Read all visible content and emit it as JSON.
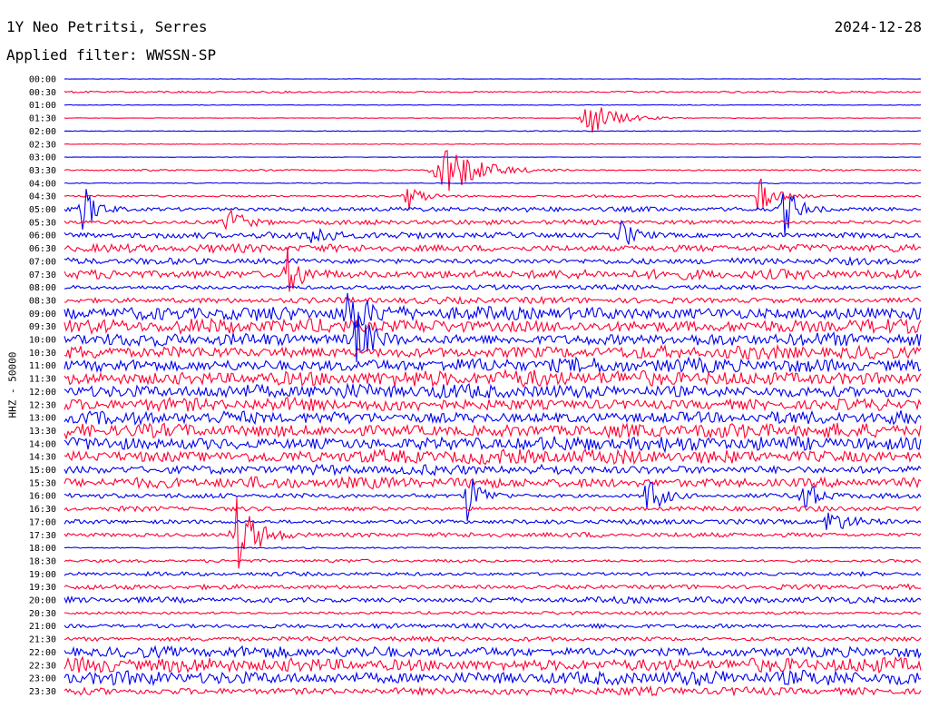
{
  "header": {
    "station": "1Y Neo Petritsi, Serres",
    "date": "2024-12-28",
    "filter": "Applied filter: WWSSN-SP"
  },
  "axis": {
    "ylabel": "HHZ - 50000"
  },
  "colors": {
    "blue": "#0000ee",
    "red": "#ff0033"
  },
  "chart_data": {
    "type": "line",
    "title": "1Y Neo Petritsi, Serres",
    "ylabel": "HHZ - 50000",
    "color_cycle": [
      "blue",
      "red"
    ],
    "time_labels": [
      "00:00",
      "00:30",
      "01:00",
      "01:30",
      "02:00",
      "02:30",
      "03:00",
      "03:30",
      "04:00",
      "04:30",
      "05:00",
      "05:30",
      "06:00",
      "06:30",
      "07:00",
      "07:30",
      "08:00",
      "08:30",
      "09:00",
      "09:30",
      "10:00",
      "10:30",
      "11:00",
      "11:30",
      "12:00",
      "12:30",
      "13:00",
      "13:30",
      "14:00",
      "14:30",
      "15:00",
      "15:30",
      "16:00",
      "16:30",
      "17:00",
      "17:30",
      "18:00",
      "18:30",
      "19:00",
      "19:30",
      "20:00",
      "20:30",
      "21:00",
      "21:30",
      "22:00",
      "22:30",
      "23:00",
      "23:30"
    ],
    "noise_level": [
      0.3,
      1.2,
      0.4,
      0.4,
      0.5,
      0.5,
      0.3,
      1.0,
      0.6,
      1.5,
      3.0,
      3.0,
      4.0,
      5.0,
      4.0,
      6.0,
      3.0,
      4.0,
      9.0,
      9.0,
      8.0,
      8.0,
      9.0,
      10.0,
      9.0,
      8.0,
      8.0,
      9.0,
      9.0,
      9.0,
      6.0,
      7.0,
      3.0,
      3.0,
      3.0,
      3.0,
      1.0,
      2.0,
      2.5,
      3.0,
      4.0,
      2.0,
      3.0,
      3.0,
      7.0,
      9.0,
      9.0,
      5.0
    ],
    "events": [
      {
        "row": 3,
        "pos": 0.61,
        "amp": 22,
        "len": 0.04
      },
      {
        "row": 7,
        "pos": 0.44,
        "amp": 34,
        "len": 0.05
      },
      {
        "row": 9,
        "pos": 0.4,
        "amp": 18,
        "len": 0.02
      },
      {
        "row": 10,
        "pos": 0.02,
        "amp": 30,
        "len": 0.02
      },
      {
        "row": 9,
        "pos": 0.81,
        "amp": 24,
        "len": 0.02
      },
      {
        "row": 10,
        "pos": 0.84,
        "amp": 30,
        "len": 0.02
      },
      {
        "row": 11,
        "pos": 0.19,
        "amp": 20,
        "len": 0.02
      },
      {
        "row": 12,
        "pos": 0.29,
        "amp": 16,
        "len": 0.02
      },
      {
        "row": 12,
        "pos": 0.65,
        "amp": 16,
        "len": 0.02
      },
      {
        "row": 15,
        "pos": 0.26,
        "amp": 28,
        "len": 0.02
      },
      {
        "row": 18,
        "pos": 0.33,
        "amp": 26,
        "len": 0.02
      },
      {
        "row": 20,
        "pos": 0.34,
        "amp": 34,
        "len": 0.02
      },
      {
        "row": 32,
        "pos": 0.47,
        "amp": 30,
        "len": 0.02
      },
      {
        "row": 32,
        "pos": 0.68,
        "amp": 28,
        "len": 0.02
      },
      {
        "row": 32,
        "pos": 0.86,
        "amp": 26,
        "len": 0.02
      },
      {
        "row": 34,
        "pos": 0.89,
        "amp": 14,
        "len": 0.03
      },
      {
        "row": 35,
        "pos": 0.2,
        "amp": 44,
        "len": 0.03
      }
    ]
  }
}
